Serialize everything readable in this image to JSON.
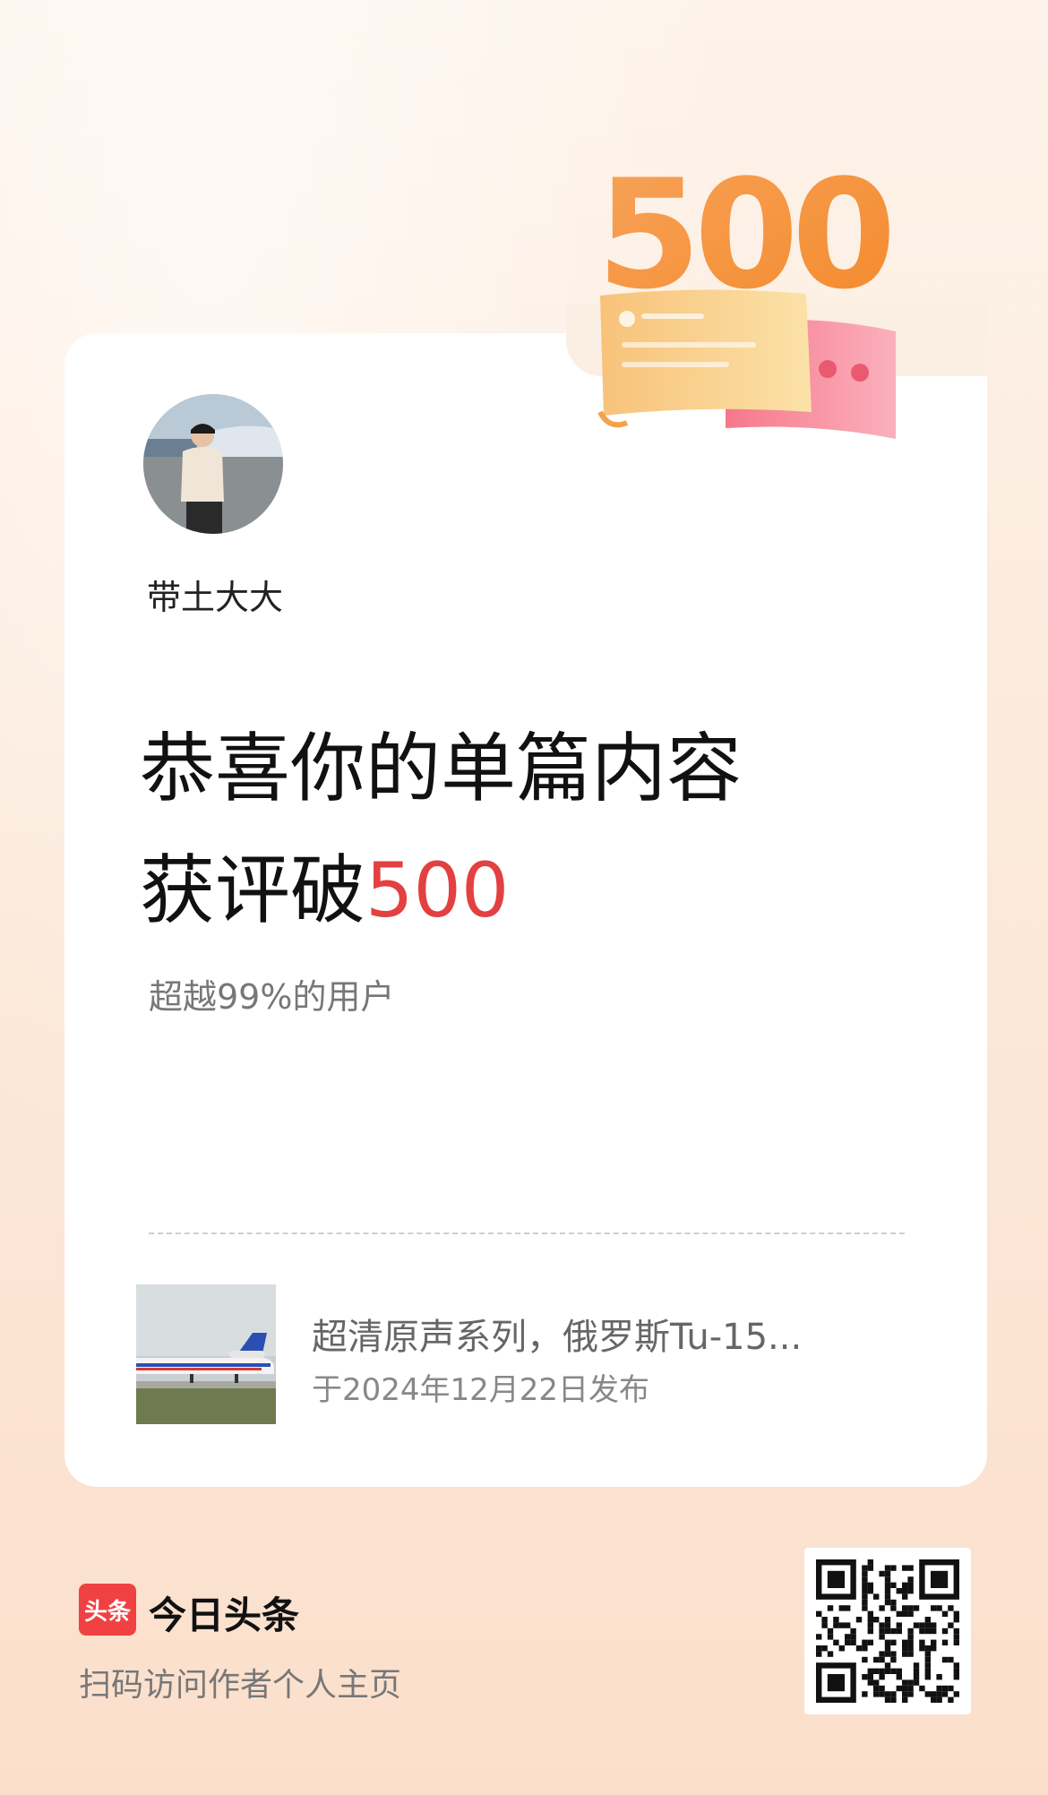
{
  "badge": {
    "number": "500"
  },
  "profile": {
    "username": "带土大大"
  },
  "headline": {
    "line1": "恭喜你的单篇内容",
    "line2_prefix": "获评破",
    "highlight": "500"
  },
  "subtitle": "超越99%的用户",
  "article": {
    "title": "超清原声系列，俄罗斯Tu-15...",
    "published": "于2024年12月22日发布"
  },
  "footer": {
    "logo_text": "头条",
    "brand": "今日头条",
    "note": "扫码访问作者个人主页"
  },
  "colors": {
    "accent": "#e34041",
    "brand_red": "#f04142",
    "badge_orange": "#f99a3c"
  }
}
